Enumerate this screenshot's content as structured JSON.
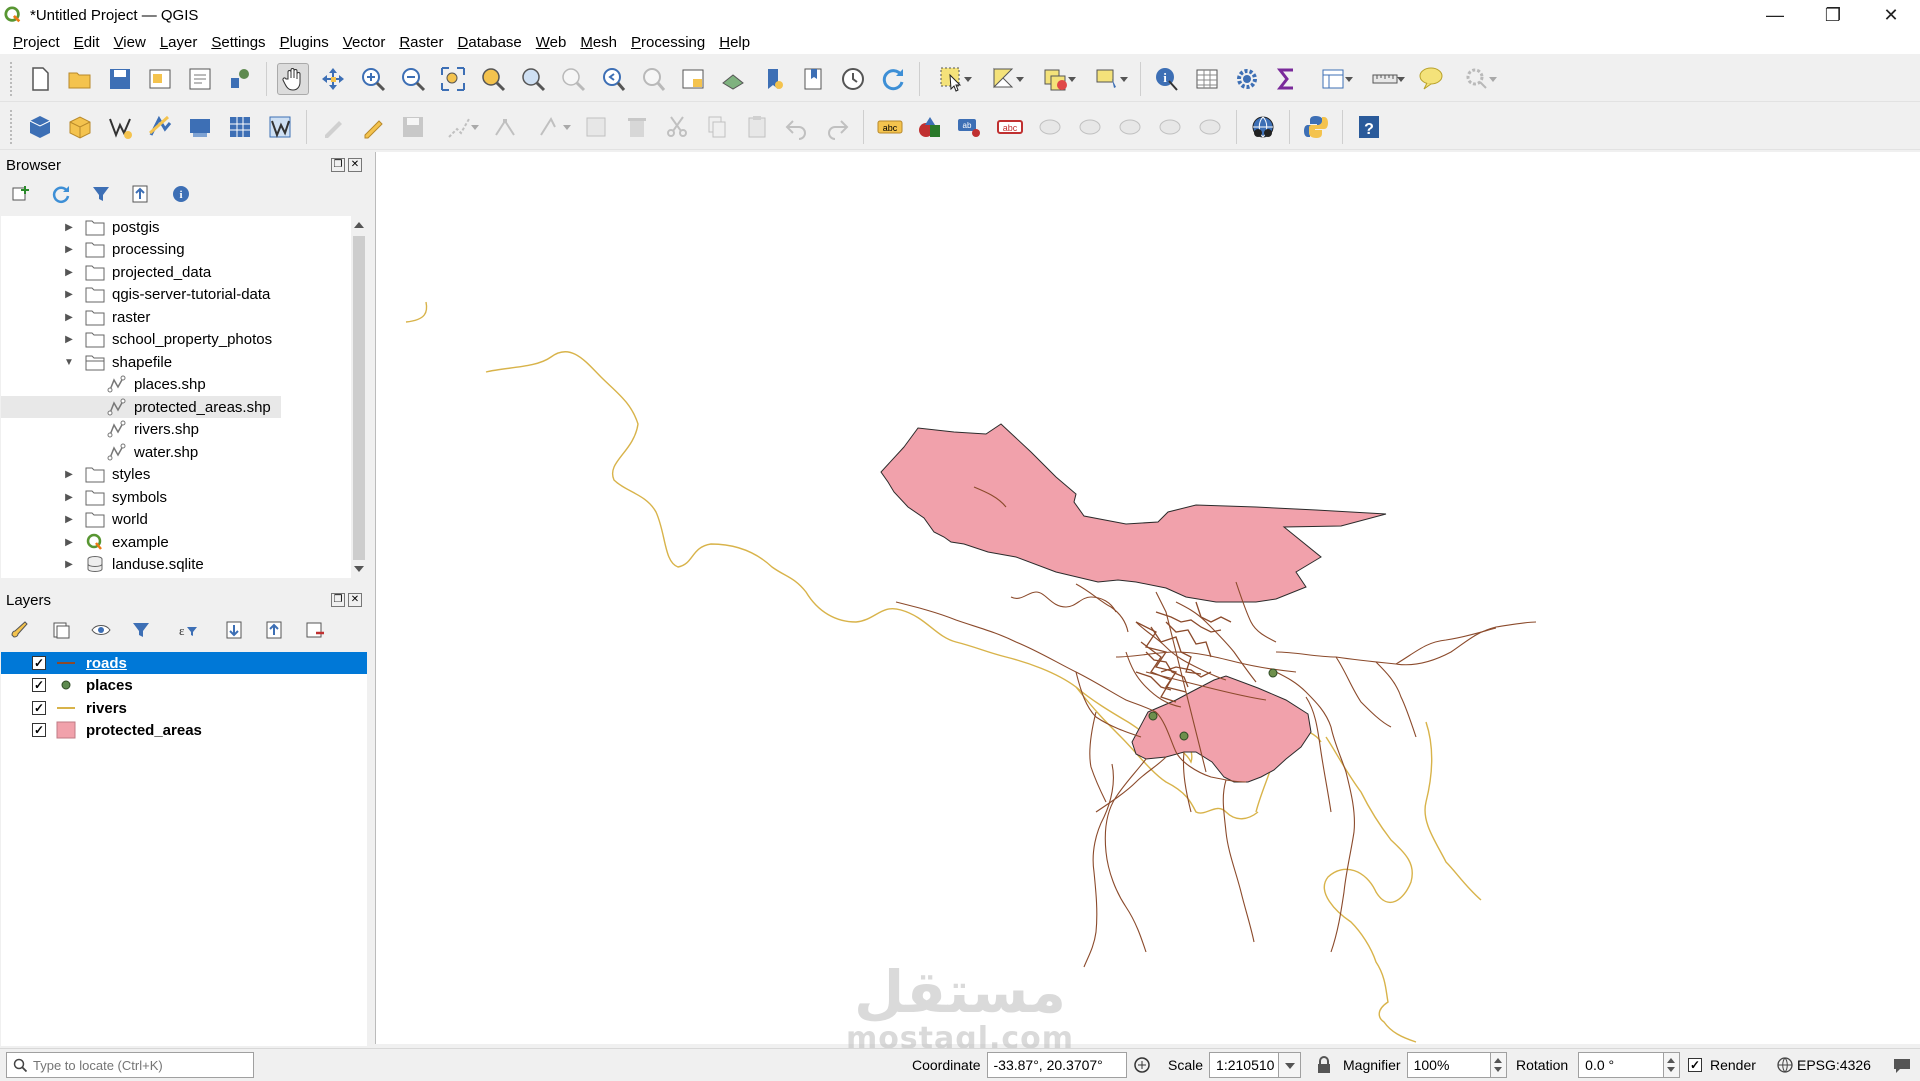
{
  "window": {
    "title": "*Untitled Project — QGIS",
    "controls": [
      "—",
      "❐",
      "✕"
    ]
  },
  "menu": [
    "Project",
    "Edit",
    "View",
    "Layer",
    "Settings",
    "Plugins",
    "Vector",
    "Raster",
    "Database",
    "Web",
    "Mesh",
    "Processing",
    "Help"
  ],
  "browser": {
    "title": "Browser",
    "items": [
      {
        "label": "postgis",
        "type": "folder",
        "expanded": false
      },
      {
        "label": "processing",
        "type": "folder",
        "expanded": false
      },
      {
        "label": "projected_data",
        "type": "folder",
        "expanded": false
      },
      {
        "label": "qgis-server-tutorial-data",
        "type": "folder",
        "expanded": false
      },
      {
        "label": "raster",
        "type": "folder",
        "expanded": false
      },
      {
        "label": "school_property_photos",
        "type": "folder",
        "expanded": false
      },
      {
        "label": "shapefile",
        "type": "folder",
        "expanded": true
      },
      {
        "label": "places.shp",
        "type": "shp"
      },
      {
        "label": "protected_areas.shp",
        "type": "shp",
        "selected": true
      },
      {
        "label": "rivers.shp",
        "type": "shp"
      },
      {
        "label": "water.shp",
        "type": "shp"
      },
      {
        "label": "styles",
        "type": "folder",
        "expanded": false
      },
      {
        "label": "symbols",
        "type": "folder",
        "expanded": false
      },
      {
        "label": "world",
        "type": "folder",
        "expanded": false
      },
      {
        "label": "example",
        "type": "qgis",
        "expanded": false
      },
      {
        "label": "landuse.sqlite",
        "type": "db",
        "expanded": false
      }
    ]
  },
  "layers": {
    "title": "Layers",
    "items": [
      {
        "label": "roads",
        "symbol": "line",
        "color": "#8b4a2b",
        "checked": true,
        "selected": true
      },
      {
        "label": "places",
        "symbol": "point",
        "color": "#5e8a4f",
        "checked": true
      },
      {
        "label": "rivers",
        "symbol": "line",
        "color": "#d8b34a",
        "checked": true
      },
      {
        "label": "protected_areas",
        "symbol": "fill",
        "color": "#f1a1ab",
        "checked": true
      }
    ]
  },
  "map": {
    "colors": {
      "roads": "#8b4a2b",
      "rivers": "#d8b34a",
      "protected_fill": "#f1a1ab",
      "places": "#6e8f4c"
    }
  },
  "statusbar": {
    "locator_placeholder": "Type to locate (Ctrl+K)",
    "coordinate_label": "Coordinate",
    "coordinate_value": "-33.87°, 20.3707°",
    "scale_label": "Scale",
    "scale_value": "1:210510",
    "magnifier_label": "Magnifier",
    "magnifier_value": "100%",
    "rotation_label": "Rotation",
    "rotation_value": "0.0 °",
    "render_label": "Render",
    "render_checked": true,
    "crs": "EPSG:4326"
  },
  "watermark": {
    "arabic": "مستقل",
    "latin": "mostaql.com"
  }
}
